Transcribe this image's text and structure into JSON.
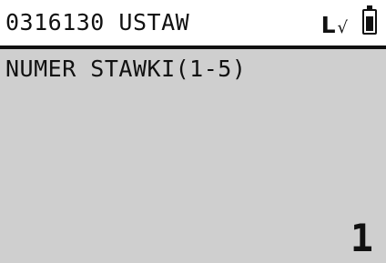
{
  "header": {
    "title": "0316130 USTAW",
    "line_indicator": "L",
    "checkmark": "√",
    "status_icons": [
      "checkmark-icon",
      "battery-icon"
    ],
    "battery_level": 1.0
  },
  "main": {
    "prompt": "NUMER STAWKI(1-5)",
    "value": "1"
  },
  "colors": {
    "screen_background": "#cfcfcf",
    "header_background": "#ffffff",
    "text": "#111111"
  }
}
